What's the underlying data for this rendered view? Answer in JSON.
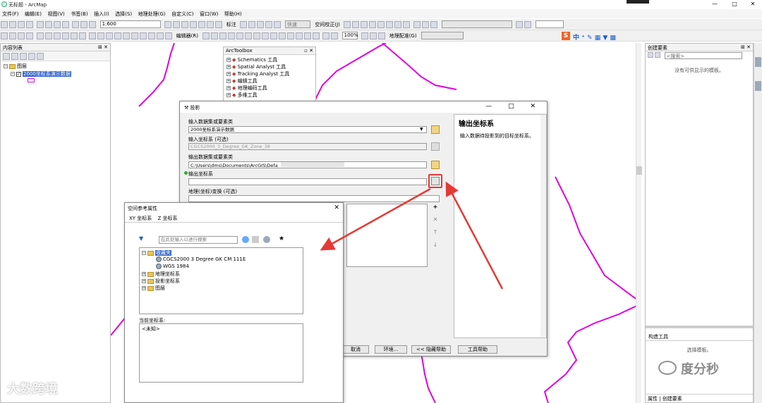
{
  "app": {
    "title": "无标题 - ArcMap"
  },
  "menu": [
    "文件(F)",
    "编辑(E)",
    "视图(V)",
    "书签(B)",
    "插入(I)",
    "选择(S)",
    "地理处理(G)",
    "自定义(C)",
    "窗口(W)",
    "帮助(H)"
  ],
  "toolbar": {
    "scale": "1:600",
    "label_btn": "标注",
    "fast": "快速",
    "spatial_adjust": "空间校正(J)",
    "editor": "编辑器(R)",
    "zoom": "100%",
    "georef": "地理配准(G)"
  },
  "toc": {
    "title": "内容列表",
    "layers_label": "图层",
    "layer_name": "2000坐标系演示数据"
  },
  "toolbox": {
    "title": "ArcToolbox",
    "items": [
      "Schematics 工具",
      "Spatial Analyst 工具",
      "Tracking Analyst 工具",
      "编辑工具",
      "地理编码工具",
      "多维工具"
    ]
  },
  "create_features": {
    "title": "创建要素",
    "search_placeholder": "<搜索>",
    "empty_text": "没有可供显示的模板。",
    "construct_tools": "构造工具",
    "select_template": "选择模板。",
    "tab_properties": "属性",
    "tab_create": "创建要素"
  },
  "project_dialog": {
    "title": "投影",
    "input_label": "输入数据集或要素类",
    "input_value": "2000坐标系演示数据",
    "input_cs_label": "输入坐标系 (可选)",
    "input_cs_value": "CGCS2000_3_Degree_GK_Zone_38",
    "output_label": "输出数据集或要素类",
    "output_value": "C:\\Users\\dms\\Documents\\ArcGIS\\Defa",
    "output_cs_label": "输出坐标系",
    "geo_transform_label": "地理(坐标)变换 (可选)",
    "help_title": "输出坐标系",
    "help_text": "输入数据待投影到的目标坐标系。",
    "buttons": {
      "cancel": "取消",
      "env": "环境...",
      "hide_help": "<< 隐藏帮助",
      "tool_help": "工具帮助"
    }
  },
  "srs_dialog": {
    "title": "空间参考属性",
    "tab_xy": "XY 坐标系",
    "tab_z": "Z 坐标系",
    "search_placeholder": "在此处输入以进行搜索",
    "tree": {
      "favorites": "收藏夹",
      "fav_items": [
        "CGCS2000 3 Degree GK CM 111E",
        "WGS 1984"
      ],
      "folders": [
        "地理坐标系",
        "投影坐标系",
        "图层"
      ]
    },
    "current_label": "当前坐标系:",
    "current_value": "<未知>"
  },
  "watermark": {
    "left": "大数跨境",
    "right": "度分秒"
  }
}
